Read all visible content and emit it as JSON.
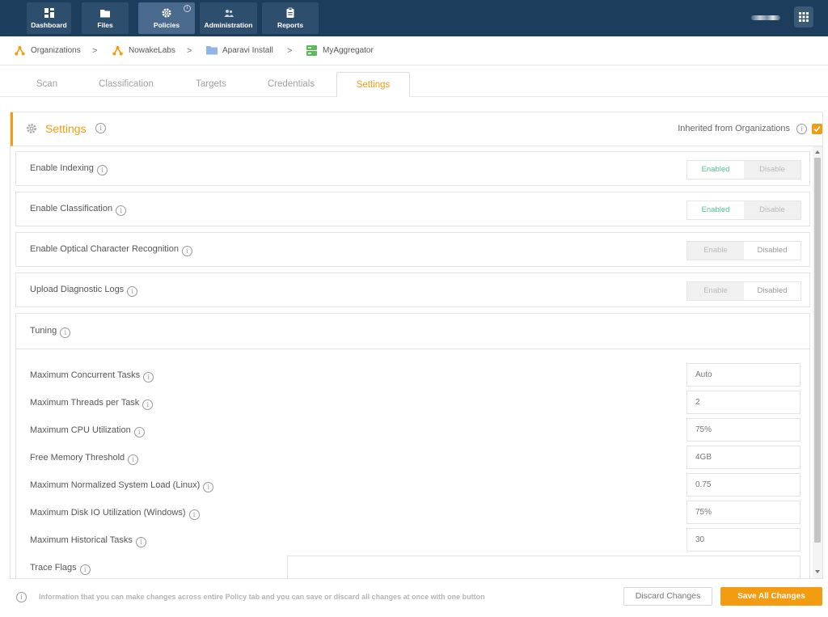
{
  "topnav": {
    "items": [
      {
        "label": "Dashboard",
        "icon": "dashboard-icon"
      },
      {
        "label": "Files",
        "icon": "folder-icon"
      },
      {
        "label": "Policies",
        "icon": "gear-icon",
        "active": true
      },
      {
        "label": "Administration",
        "icon": "users-icon"
      },
      {
        "label": "Reports",
        "icon": "clipboard-icon"
      }
    ],
    "apps_icon": "grid-icon"
  },
  "breadcrumb": [
    {
      "label": "Organizations",
      "icon": "org-icon"
    },
    {
      "label": "NowakeLabs",
      "icon": "org-icon"
    },
    {
      "label": "Aparavi Install",
      "icon": "folder-icon"
    },
    {
      "label": "MyAggregator",
      "icon": "server-icon"
    }
  ],
  "tabs": [
    "Scan",
    "Classification",
    "Targets",
    "Credentials",
    "Settings"
  ],
  "active_tab": "Settings",
  "panel": {
    "title": "Settings",
    "inherited_label": "Inherited from Organizations",
    "inherited_checked": true
  },
  "toggles": [
    {
      "label": "Enable Indexing",
      "option_a": "Enabled",
      "option_b": "Disable",
      "selected": "a"
    },
    {
      "label": "Enable Classification",
      "option_a": "Enabled",
      "option_b": "Disable",
      "selected": "a"
    },
    {
      "label": "Enable Optical Character Recognition",
      "option_a": "Enable",
      "option_b": "Disabled",
      "selected": "b"
    },
    {
      "label": "Upload Diagnostic Logs",
      "option_a": "Enable",
      "option_b": "Disabled",
      "selected": "b"
    }
  ],
  "tuning": {
    "title": "Tuning",
    "fields": [
      {
        "label": "Maximum Concurrent Tasks",
        "value": "Auto"
      },
      {
        "label": "Maximum Threads per Task",
        "value": "2"
      },
      {
        "label": "Maximum CPU Utilization",
        "value": "75%"
      },
      {
        "label": "Free Memory Threshold",
        "value": "4GB"
      },
      {
        "label": "Maximum Normalized System Load (Linux)",
        "value": "0.75"
      },
      {
        "label": "Maximum Disk IO Utilization (Windows)",
        "value": "75%"
      },
      {
        "label": "Maximum Historical Tasks",
        "value": "30"
      }
    ],
    "trace_flags": {
      "label": "Trace Flags",
      "value": ""
    }
  },
  "footer": {
    "info_text": "Information that you can make changes across entire Policy tab and you can save or discard all changes at once with one button",
    "discard_label": "Discard Changes",
    "save_label": "Save All Changes"
  },
  "colors": {
    "nav_bg": "#1d3d5c",
    "accent": "#f39c12",
    "enabled_green": "#4cc38a"
  }
}
